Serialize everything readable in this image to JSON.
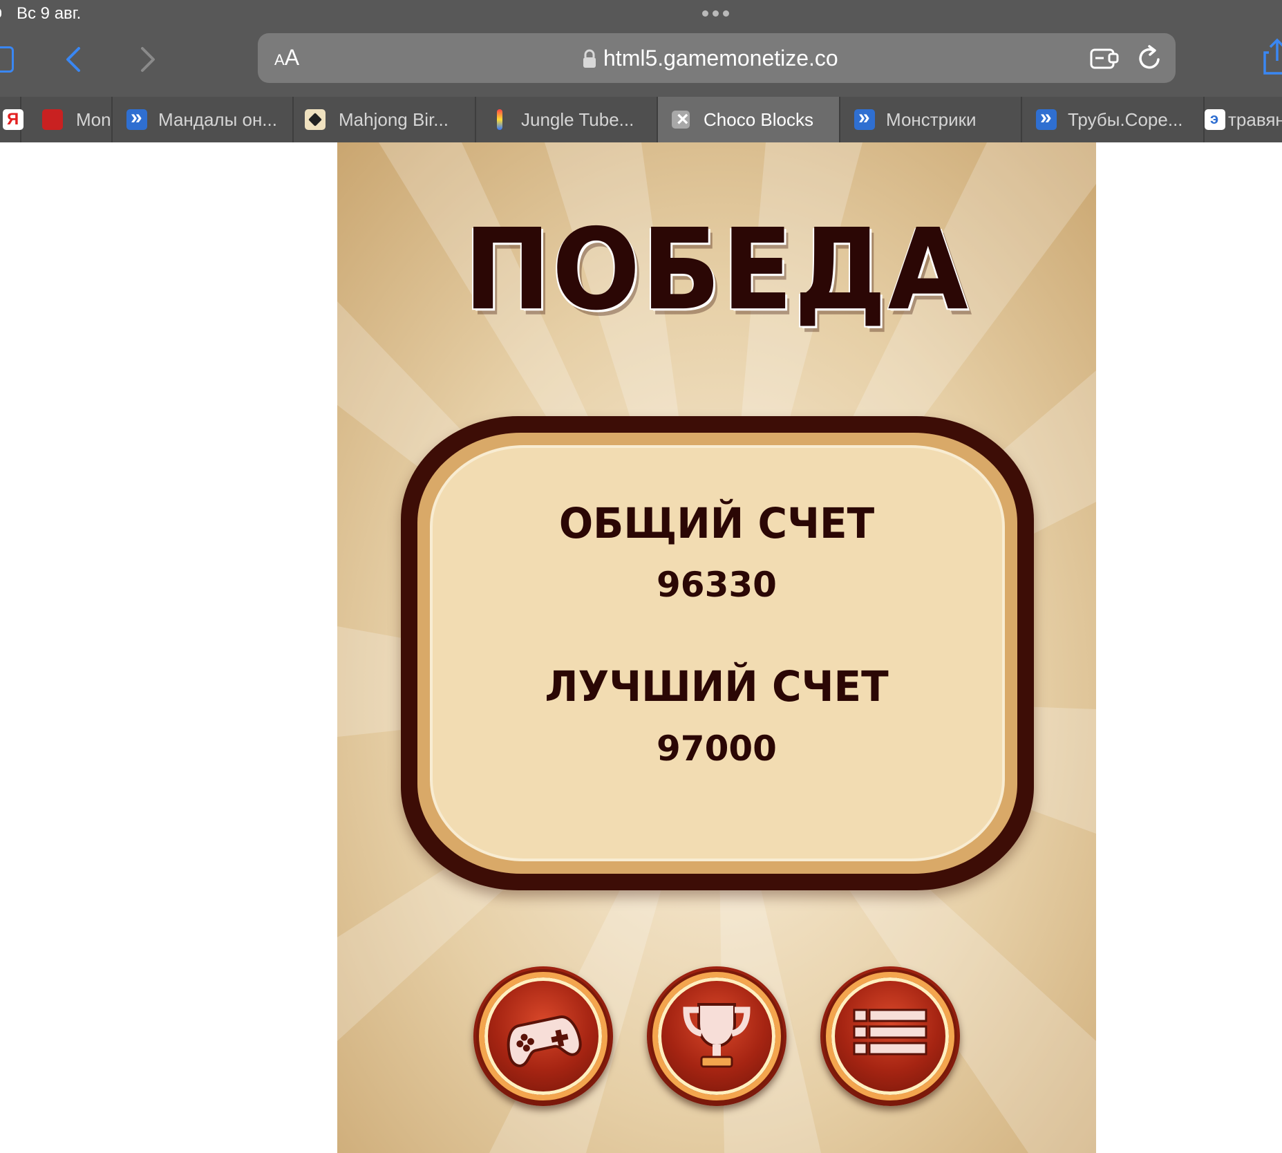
{
  "status_bar": {
    "date": "Вс 9 авг."
  },
  "browser": {
    "reader_small": "A",
    "reader_big": "A",
    "url": "html5.gamemonetize.co"
  },
  "tabs": [
    {
      "label": "",
      "favicon": "yandex-icon"
    },
    {
      "label": "Mon",
      "favicon": "monster-icon"
    },
    {
      "label": "Мандалы он...",
      "favicon": "app-icon"
    },
    {
      "label": "Mahjong Bir...",
      "favicon": "mahjong-icon"
    },
    {
      "label": "Jungle Tube...",
      "favicon": "tube-icon"
    },
    {
      "label": "Choco Blocks",
      "favicon": "close-icon",
      "active": true
    },
    {
      "label": "Монстрики",
      "favicon": "app-icon"
    },
    {
      "label": "Трубы.Соре...",
      "favicon": "app-icon"
    },
    {
      "label": "травян",
      "favicon": "round-icon"
    }
  ],
  "game": {
    "title": "ПОБЕДА",
    "total_score_label": "ОБЩИЙ СЧЕТ",
    "total_score_value": "96330",
    "best_score_label": "ЛУЧШИЙ СЧЕТ",
    "best_score_value": "97000",
    "buttons": [
      "gamepad-icon",
      "trophy-icon",
      "list-icon"
    ]
  },
  "colors": {
    "title_text": "#2b0705",
    "panel_border": "#3d0d06",
    "panel_fill": "#f2dcb2",
    "button_ring": "#f3a54e",
    "link_blue": "#3a87f3"
  }
}
